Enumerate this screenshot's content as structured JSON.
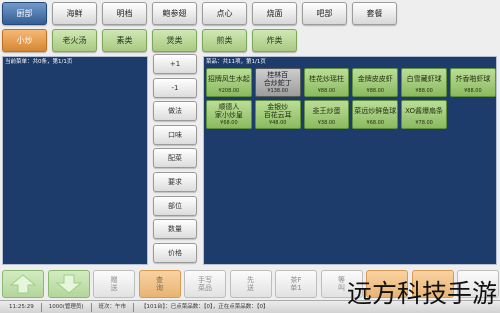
{
  "colors": {
    "panel_bg": "#1d3c6c",
    "selected_tab": "#3f72b4",
    "selected_subtab": "#f39a3a",
    "subtab_green": "#b7db8c",
    "dish_green": "#9ccf6a",
    "dish_selected": "#b8b8b8",
    "action_orange": "#f7bf7a",
    "scroll_green": "#bfe3a6"
  },
  "top_tabs": [
    {
      "label": "厨部",
      "selected": true
    },
    {
      "label": "海鲜",
      "selected": false
    },
    {
      "label": "明档",
      "selected": false
    },
    {
      "label": "鲍参翅",
      "selected": false
    },
    {
      "label": "点心",
      "selected": false
    },
    {
      "label": "烧面",
      "selected": false
    },
    {
      "label": "吧部",
      "selected": false
    },
    {
      "label": "套餐",
      "selected": false
    }
  ],
  "sub_tabs": [
    {
      "label": "小炒",
      "selected": true
    },
    {
      "label": "老火汤",
      "selected": false
    },
    {
      "label": "素类",
      "selected": false
    },
    {
      "label": "煲类",
      "selected": false
    },
    {
      "label": "煎类",
      "selected": false
    },
    {
      "label": "炸类",
      "selected": false
    }
  ],
  "order_panel": {
    "header": "当前菜单：共0条，第1/1页"
  },
  "side_actions": [
    "+1",
    "-1",
    "做法",
    "口味",
    "配菜",
    "要求",
    "部位",
    "数量",
    "价格"
  ],
  "dish_panel": {
    "header": "菜品：共11项，第1/1页",
    "dishes": [
      {
        "name": "招牌风生水起",
        "price": "¥208.00",
        "selected": false
      },
      {
        "name": "桂林百\n合炒蛇丁",
        "price": "¥138.00",
        "selected": true
      },
      {
        "name": "桂花炒瑶柱",
        "price": "¥88.00",
        "selected": false
      },
      {
        "name": "金牌皮皮虾",
        "price": "¥88.00",
        "selected": false
      },
      {
        "name": "白雪藏虾球",
        "price": "¥88.00",
        "selected": false
      },
      {
        "name": "芥香啪虾球",
        "price": "¥88.00",
        "selected": false
      },
      {
        "name": "顺德人\n家小炒皇",
        "price": "¥68.00",
        "selected": false
      },
      {
        "name": "金银炒\n百花云耳",
        "price": "¥48.00",
        "selected": false
      },
      {
        "name": "韭王炒蛋",
        "price": "¥38.00",
        "selected": false
      },
      {
        "name": "菜远炒鲜鱼球",
        "price": "¥68.00",
        "selected": false
      },
      {
        "name": "XO酱爆扇条",
        "price": "¥78.00",
        "selected": false
      }
    ]
  },
  "bottom_bar": {
    "scroll_up": {
      "icon": "up-arrow-icon"
    },
    "scroll_down": {
      "icon": "down-arrow-icon"
    },
    "buttons": [
      {
        "label": "赠\n送"
      },
      {
        "label": "查\n询"
      },
      {
        "label": "手写\n菜品"
      },
      {
        "label": "先\n送"
      },
      {
        "label": "茶F\n单1"
      },
      {
        "label": "等\n叫"
      },
      {
        "label": ""
      },
      {
        "label": ""
      },
      {
        "label": ""
      }
    ]
  },
  "status_bar": {
    "time": "11:25:29",
    "user": "1000(管理员)",
    "shift": "班次：午市",
    "table_info": "【101台】：已点菜品数：【0】，正在点菜品数：【0】"
  },
  "watermark": "远方科技手游"
}
